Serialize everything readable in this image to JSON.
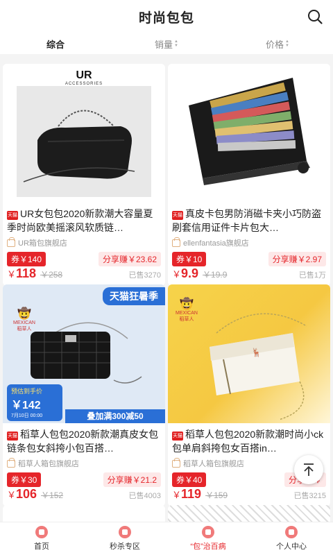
{
  "header": {
    "title": "时尚包包"
  },
  "sortbar": {
    "tabs": [
      {
        "label": "综合"
      },
      {
        "label": "销量"
      },
      {
        "label": "价格"
      }
    ]
  },
  "products": [
    {
      "title": "UR女包包2020新款潮大容量夏季时尚欧美摇滚风软质链…",
      "badge": "天猫",
      "shop": "UR箱包旗舰店",
      "coupon": "券￥140",
      "share": "分享赚￥23.62",
      "price_symbol": "￥",
      "price": "118",
      "orig": "￥258",
      "sold": "已售3270",
      "image": {
        "brand": "UR",
        "sub": "ACCESSORIES"
      }
    },
    {
      "title": "真皮卡包男防消磁卡夹小巧防盗刷套信用证件卡片包大…",
      "badge": "天猫",
      "shop": "ellenfantasia旗舰店",
      "coupon": "券￥10",
      "share": "分享赚￥2.97",
      "price_symbol": "￥",
      "price": "9.9",
      "orig": "￥19.9",
      "sold": "已售1万"
    },
    {
      "title": "稻草人包包2020新款潮真皮女包链条包女斜挎小包百搭…",
      "badge": "天猫",
      "shop": "稻草人箱包旗舰店",
      "coupon": "券￥30",
      "share": "分享赚￥21.2",
      "price_symbol": "￥",
      "price": "106",
      "orig": "￥152",
      "sold": "已售4003",
      "image": {
        "banner": "天猫狂暑季",
        "brand": "稻草人",
        "brand_en": "MEXICAN",
        "promo_label": "预估到手价",
        "promo_price": "￥142",
        "promo_date": "7月10日 00:00",
        "bottom_banner": "叠加满300减50"
      }
    },
    {
      "title": "稻草人包包2020新款潮时尚小ck包单肩斜挎包女百搭in…",
      "badge": "天猫",
      "shop": "稻草人箱包旗舰店",
      "coupon": "券￥40",
      "share": "分享赚￥",
      "price_symbol": "￥",
      "price": "119",
      "orig": "￥159",
      "sold": "已售3215",
      "image": {
        "brand": "稻草人",
        "brand_en": "MEXICAN"
      }
    }
  ],
  "tabbar": {
    "items": [
      {
        "label": "首页"
      },
      {
        "label": "秒杀专区"
      },
      {
        "label": "“包”治百病"
      },
      {
        "label": "个人中心"
      }
    ]
  },
  "colors": {
    "accent": "#e5252a",
    "share_bg": "#fde8e8",
    "gold": "#f5c842"
  }
}
